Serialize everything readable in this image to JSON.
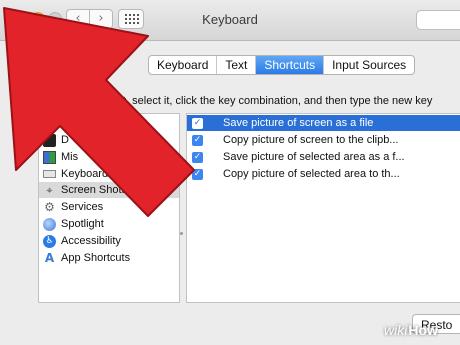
{
  "window": {
    "title": "Keyboard",
    "nav_back_glyph": "‹",
    "nav_forward_glyph": "›"
  },
  "tabs": [
    {
      "label": "Keyboard",
      "active": false
    },
    {
      "label": "Text",
      "active": false
    },
    {
      "label": "Shortcuts",
      "active": true
    },
    {
      "label": "Input Sources",
      "active": false
    }
  ],
  "instructions": "To                      ut, select it, click the key combination, and then type the new key",
  "categories": [
    {
      "label": "",
      "icon": "launchpad-dock-icon",
      "selected": false
    },
    {
      "label": "D",
      "icon": "display-icon",
      "selected": false
    },
    {
      "label": "Mis          Control",
      "icon": "mission-control-icon",
      "selected": false
    },
    {
      "label": "Keyboard",
      "icon": "keyboard-icon",
      "selected": false
    },
    {
      "label": "Screen Shots",
      "icon": "screenshot-icon",
      "selected": true
    },
    {
      "label": "Services",
      "icon": "gear-icon",
      "selected": false
    },
    {
      "label": "Spotlight",
      "icon": "spotlight-icon",
      "selected": false
    },
    {
      "label": "Accessibility",
      "icon": "accessibility-icon",
      "selected": false
    },
    {
      "label": "App Shortcuts",
      "icon": "app-store-icon",
      "selected": false
    }
  ],
  "shortcuts": [
    {
      "label": "Save picture of screen as a file",
      "checked": true,
      "selected": true
    },
    {
      "label": "Copy picture of screen to the clipb...",
      "checked": true,
      "selected": false
    },
    {
      "label": "Save picture of selected area as a f...",
      "checked": true,
      "selected": false
    },
    {
      "label": "Copy picture of selected area to th...",
      "checked": true,
      "selected": false
    }
  ],
  "restore_label": "Resto",
  "checkmark_glyph": "✓",
  "watermark": {
    "prefix": "wiki",
    "suffix": "How"
  },
  "colors": {
    "arrow": "#e2232a",
    "selection": "#2a6fd6",
    "tab_active": "#3b8cf0",
    "close_button": "#f25a51"
  }
}
